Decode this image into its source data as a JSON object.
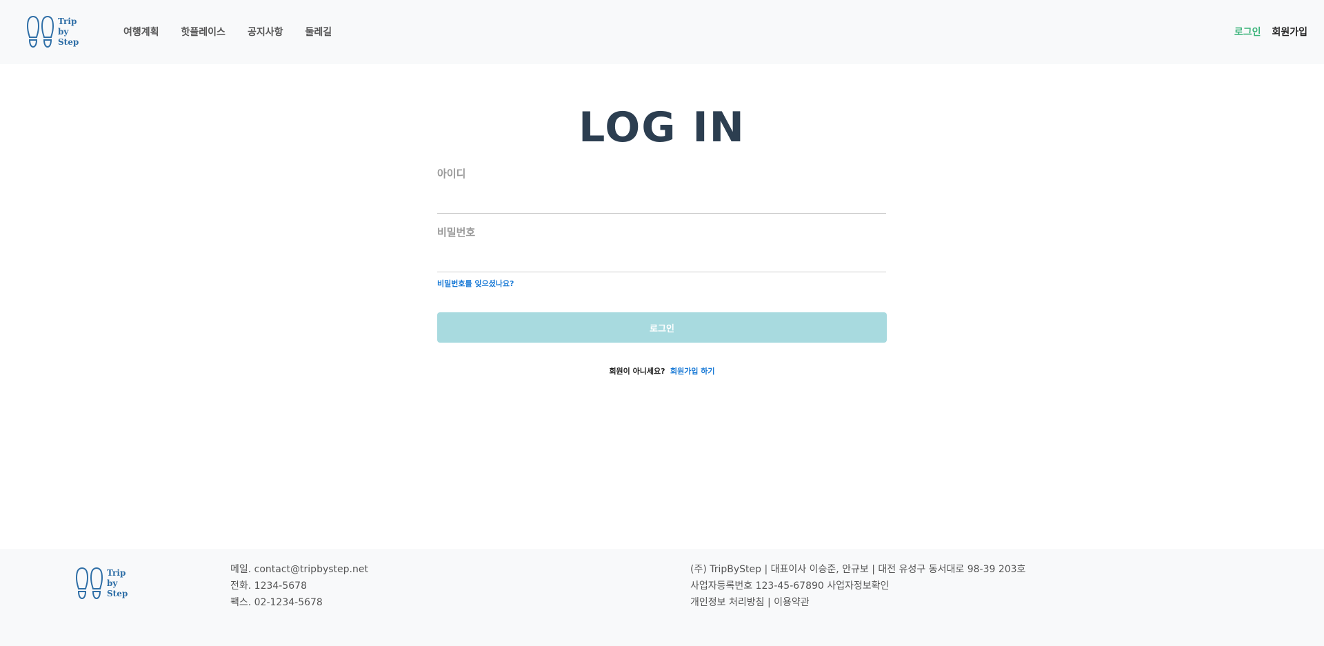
{
  "brand": {
    "line1": "Trip",
    "line2": "by",
    "line3": "Step",
    "color": "#2e6ea6"
  },
  "nav": {
    "items": [
      {
        "label": "여행계획"
      },
      {
        "label": "핫플레이스"
      },
      {
        "label": "공지사항"
      },
      {
        "label": "둘레길"
      }
    ]
  },
  "auth": {
    "login_label": "로그인",
    "signup_label": "회원가입"
  },
  "login": {
    "title": "LOG IN",
    "id_label": "아이디",
    "id_value": "",
    "password_label": "비밀번호",
    "password_value": "",
    "forgot_label": "비밀번호를 잊으셨나요?",
    "submit_label": "로그인",
    "signup_prompt": "회원이 아니세요?",
    "signup_link": "회원가입 하기"
  },
  "footer": {
    "mail": "메일. contact@tripbystep.net",
    "phone": "전화. 1234-5678",
    "fax": "팩스. 02-1234-5678",
    "company": "(주) TripByStep | 대표이사 이승준, 안규보 | 대전 유성구 동서대로 98-39 203호",
    "registration": "사업자등록번호 123-45-67890 사업자정보확인",
    "policy": "개인정보 처리방침 | 이용약관"
  },
  "colors": {
    "accent_green": "#3bb37a",
    "button_bg": "#a8dadf",
    "link_blue": "#1a7ad6",
    "title": "#2c3e50"
  }
}
